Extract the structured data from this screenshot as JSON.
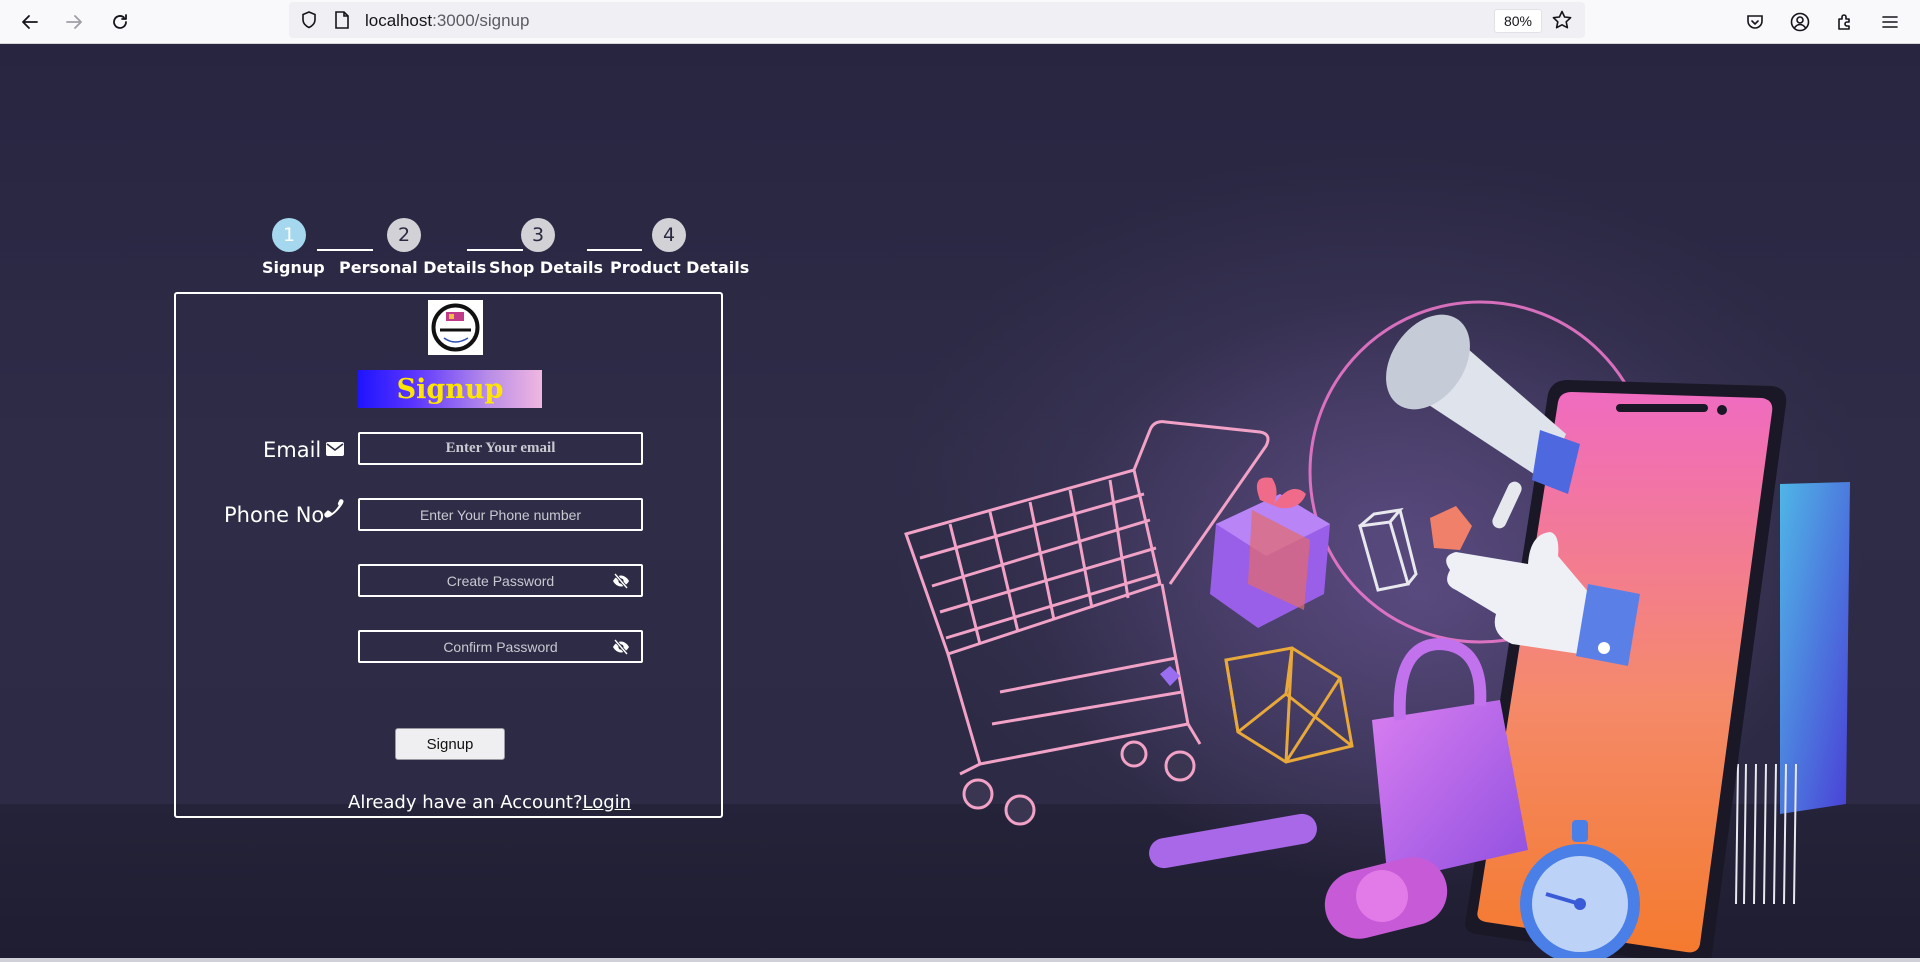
{
  "browser": {
    "url_host": "localhost",
    "url_path": ":3000/signup",
    "zoom": "80%",
    "icons": [
      "back-arrow-icon",
      "forward-arrow-icon",
      "reload-icon",
      "shield-icon",
      "page-icon",
      "bookmark-star-icon",
      "pocket-icon",
      "account-icon",
      "extensions-icon",
      "menu-icon"
    ]
  },
  "steps": [
    {
      "number": "1",
      "label": "Signup",
      "active": true
    },
    {
      "number": "2",
      "label": "Personal Details",
      "active": false
    },
    {
      "number": "3",
      "label": "Shop Details",
      "active": false
    },
    {
      "number": "4",
      "label": "Product Details",
      "active": false
    }
  ],
  "form": {
    "heading": "Signup",
    "email_label": "Email",
    "email_placeholder": "Enter Your email",
    "phone_label": "Phone No",
    "phone_placeholder": "Enter Your Phone number",
    "password_placeholder": "Create Password",
    "confirm_placeholder": "Confirm Password",
    "submit_label": "Signup",
    "account_text": "Already have an Account?",
    "login_link": "Login"
  },
  "colors": {
    "page_bg": "#2b2942",
    "active_step": "#a5d8ee",
    "inactive_step": "#d2d2d6",
    "heading_text": "#ffe600"
  }
}
